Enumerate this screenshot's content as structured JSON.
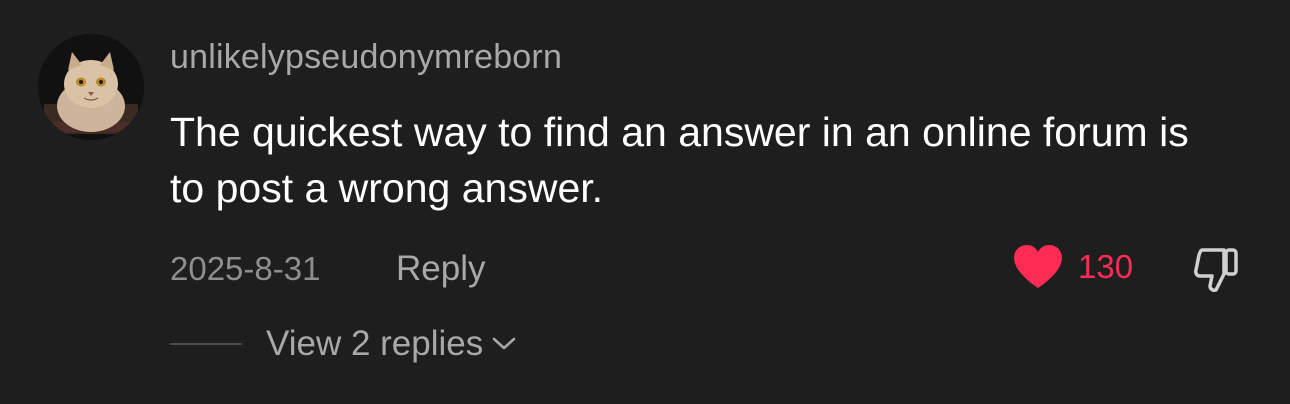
{
  "comment": {
    "username": "unlikelypseudonymreborn",
    "text": "The quickest way to find an answer in an online forum is to post a wrong answer.",
    "date": "2025-8-31",
    "reply_label": "Reply",
    "like_count": "130",
    "liked": true,
    "avatar_icon": "cat-avatar",
    "view_replies_label": "View 2 replies"
  },
  "colors": {
    "background": "#1e1e1e",
    "like_accent": "#fe2c55",
    "secondary_text": "#a8a8a8",
    "primary_text": "#ffffff"
  }
}
